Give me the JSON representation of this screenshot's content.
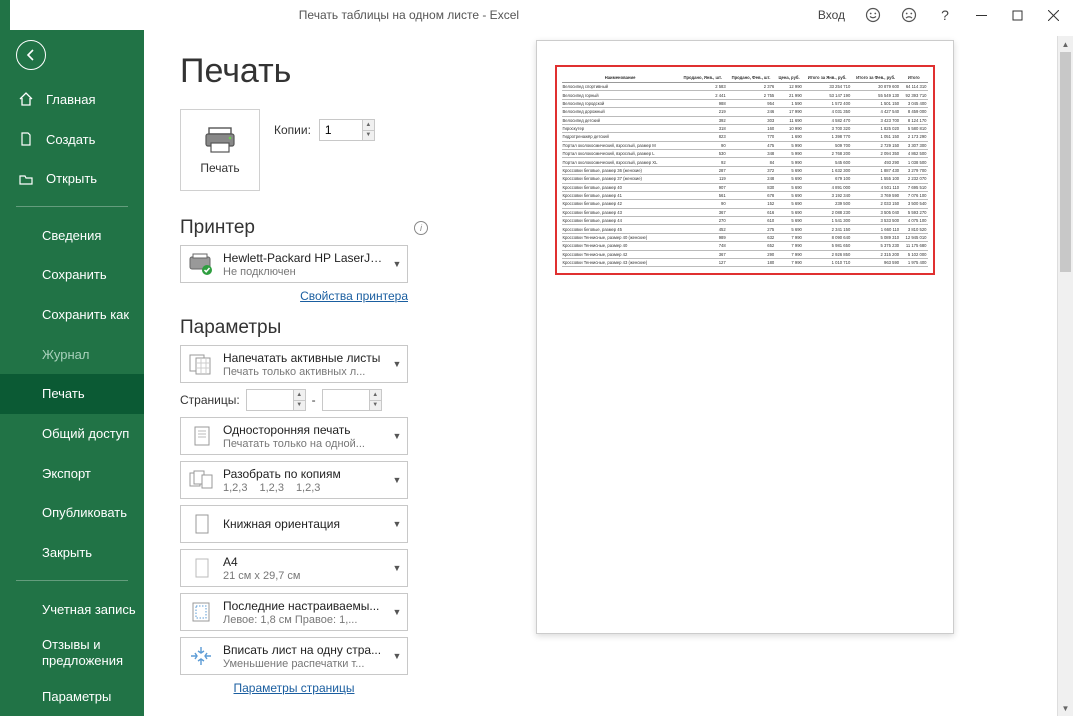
{
  "titlebar": {
    "title": "Печать таблицы на одном листе  -  Excel",
    "login": "Вход"
  },
  "sidebar": {
    "home": "Главная",
    "new": "Создать",
    "open": "Открыть",
    "info": "Сведения",
    "save": "Сохранить",
    "saveas": "Сохранить как",
    "history": "Журнал",
    "print": "Печать",
    "share": "Общий доступ",
    "export": "Экспорт",
    "publish": "Опубликовать",
    "close": "Закрыть",
    "account": "Учетная запись",
    "feedback": "Отзывы и предложения",
    "options": "Параметры"
  },
  "page": {
    "heading": "Печать",
    "print_label": "Печать",
    "copies_label": "Копии:",
    "copies_value": "1",
    "printer_heading": "Принтер",
    "printer": {
      "name": "Hewlett-Packard HP LaserJe...",
      "status": "Не подключен"
    },
    "printer_props": "Свойства принтера",
    "settings_heading": "Параметры",
    "what": {
      "t1": "Напечатать активные листы",
      "t2": "Печать только активных л..."
    },
    "pages_label": "Страницы:",
    "pages_from": "",
    "pages_sep": "-",
    "pages_to": "",
    "sides": {
      "t1": "Односторонняя печать",
      "t2": "Печатать только на одной..."
    },
    "collate": {
      "t1": "Разобрать по копиям",
      "seq1": "1,2,3",
      "seq2": "1,2,3",
      "seq3": "1,2,3"
    },
    "orient": {
      "t1": "Книжная ориентация"
    },
    "paper": {
      "t1": "A4",
      "t2": "21 см x 29,7 см"
    },
    "margins": {
      "t1": "Последние настраиваемы...",
      "t2": "Левое:  1,8 см    Правое:  1,..."
    },
    "fit": {
      "t1": "Вписать лист на одну стра...",
      "t2": "Уменьшение распечатки т..."
    },
    "page_setup": "Параметры страницы"
  },
  "preview": {
    "title": "Наименование",
    "headers": [
      "Наименование",
      "Продано, Янв., шт.",
      "Продано, Фев., шт.",
      "Цена, руб.",
      "Итого за Янв., руб.",
      "Итого за Фев., руб.",
      "Итого"
    ],
    "rows": [
      [
        "Велосипед спортивный",
        "2 583",
        "2 376",
        "12 990",
        "33 254 710",
        "30 879 600",
        "64 114 310"
      ],
      [
        "Велосипед горный",
        "2 441",
        "2 755",
        "21 990",
        "53 147 190",
        "55 549 130",
        "92 393 710"
      ],
      [
        "Велосипед городской",
        "988",
        "954",
        "1 590",
        "1 572 400",
        "1 501 150",
        "3 045 400"
      ],
      [
        "Велосипед дорожный",
        "219",
        "246",
        "17 990",
        "4 031 350",
        "4 427 540",
        "8 459 000"
      ],
      [
        "Велосипед детский",
        "392",
        "303",
        "11 690",
        "4 582 470",
        "3 423 700",
        "8 124 170"
      ],
      [
        "Гироскутер",
        "318",
        "160",
        "10 990",
        "3 700 320",
        "1 825 020",
        "5 580 810"
      ],
      [
        "Гидротренажёр детский",
        "823",
        "770",
        "1 690",
        "1 398 770",
        "1 051 150",
        "2 173 290"
      ],
      [
        "Портал околокосмический, взрослый, размер М",
        "90",
        "475",
        "5 990",
        "509 700",
        "2 729 150",
        "3 307 300"
      ],
      [
        "Портал околокосмический, взрослый, размер L",
        "530",
        "348",
        "5 990",
        "2 768 200",
        "2 094 350",
        "4 862 500"
      ],
      [
        "Портал околокосмический, взрослый, размер XL",
        "92",
        "84",
        "5 990",
        "545 600",
        "493 290",
        "1 038 500"
      ],
      [
        "Кроссовки беговые, размер 36 (женские)",
        "287",
        "372",
        "5 690",
        "1 632 300",
        "1 887 430",
        "3 279 700"
      ],
      [
        "Кроссовки беговые, размер 37 (женские)",
        "119",
        "248",
        "5 690",
        "679 100",
        "1 555 100",
        "2 232 070"
      ],
      [
        "Кроссовки беговые, размер 40",
        "907",
        "830",
        "5 690",
        "4 891 000",
        "4 501 110",
        "7 695 510"
      ],
      [
        "Кроссовки беговые, размер 41",
        "561",
        "678",
        "5 690",
        "3 192 340",
        "3 769 590",
        "7 076 100"
      ],
      [
        "Кроссовки беговые, размер 42",
        "90",
        "152",
        "5 690",
        "239 500",
        "2 033 150",
        "3 500 540"
      ],
      [
        "Кроссовки беговые, размер 43",
        "367",
        "616",
        "5 690",
        "2 088 230",
        "3 505 040",
        "5 593 270"
      ],
      [
        "Кроссовки беговые, размер 44",
        "270",
        "610",
        "5 690",
        "1 541 300",
        "3 533 500",
        "4 075 100"
      ],
      [
        "Кроссовки беговые, размер 45",
        "452",
        "275",
        "5 690",
        "2 341 150",
        "1 660 110",
        "3 810 520"
      ],
      [
        "Кроссовки Теннисные, размер 40 (женские)",
        "989",
        "632",
        "7 990",
        "8 090 640",
        "5 089 310",
        "12 945 010"
      ],
      [
        "Кроссовки Теннисные, размер 40",
        "748",
        "652",
        "7 990",
        "5 981 650",
        "5 375 230",
        "11 175 680"
      ],
      [
        "Кроссовки Теннисные, размер 42",
        "367",
        "290",
        "7 990",
        "2 926 850",
        "2 315 200",
        "5 102 000"
      ],
      [
        "Кроссовки Теннисные, размер 43 (женские)",
        "127",
        "180",
        "7 990",
        "1 010 710",
        "963 590",
        "1 975 400"
      ]
    ]
  }
}
